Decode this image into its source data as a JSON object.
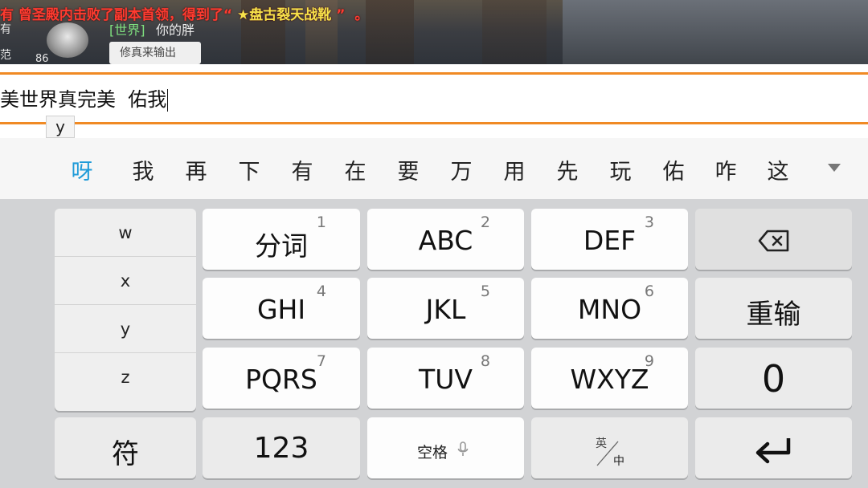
{
  "game": {
    "announcement_prefix": "有",
    "announcement_text": "曾圣殿内击败了副本首领，得到了“",
    "announcement_item": "★盘古裂天战靴",
    "announcement_close": "”",
    "announcement_tail": "。",
    "side_char_1": "有",
    "side_char_2": "范",
    "level": "86",
    "chat_channel": "[世界]",
    "chat_name": "你的胖",
    "chat_message": "修真来输出"
  },
  "input": {
    "text": "美世界真完美  佑我",
    "pinyin": "y"
  },
  "candidates": [
    "呀",
    "我",
    "再",
    "下",
    "有",
    "在",
    "要",
    "万",
    "用",
    "先",
    "玩",
    "佑",
    "咋",
    "这"
  ],
  "pinyin_options": [
    "w",
    "x",
    "y",
    "z"
  ],
  "keys": {
    "row1": [
      {
        "label": "分词",
        "num": "1"
      },
      {
        "label": "ABC",
        "num": "2"
      },
      {
        "label": "DEF",
        "num": "3"
      }
    ],
    "row2": [
      {
        "label": "GHI",
        "num": "4"
      },
      {
        "label": "JKL",
        "num": "5"
      },
      {
        "label": "MNO",
        "num": "6"
      }
    ],
    "row3": [
      {
        "label": "PQRS",
        "num": "7"
      },
      {
        "label": "TUV",
        "num": "8"
      },
      {
        "label": "WXYZ",
        "num": "9"
      }
    ],
    "reinput": "重输",
    "zero": "0",
    "symbol": "符",
    "num_mode": "123",
    "space": "空格",
    "lang_en": "英",
    "lang_zh": "中"
  },
  "colors": {
    "accent_orange": "#f08a24",
    "candidate_highlight": "#1f9bd8",
    "announce_red": "#ff3b30",
    "item_yellow": "#f7e24a"
  },
  "icons": {
    "backspace": "backspace-icon",
    "enter": "enter-icon",
    "mic": "mic-icon",
    "expand": "chevron-down-icon"
  }
}
